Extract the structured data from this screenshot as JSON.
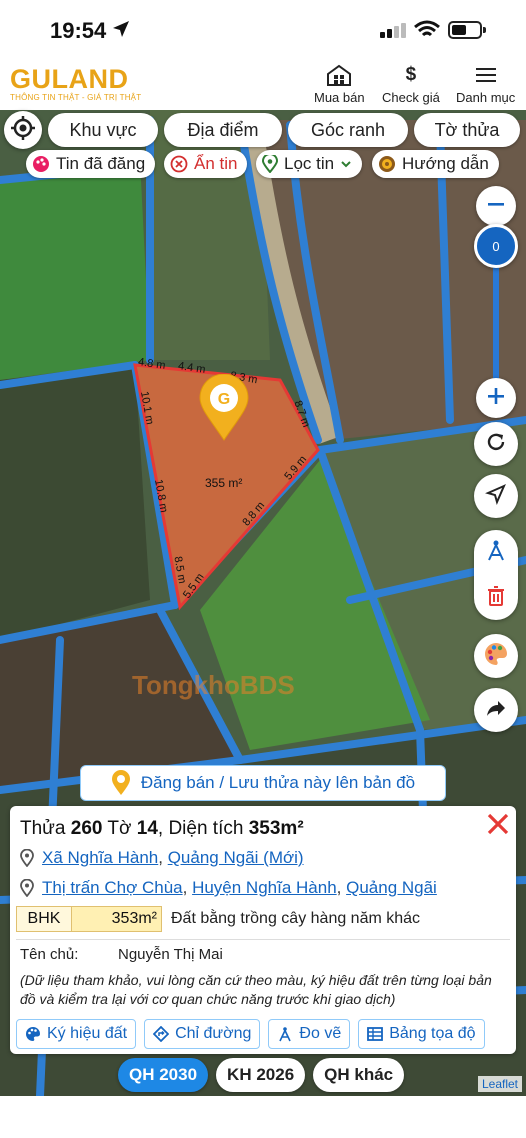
{
  "status_bar": {
    "time": "19:54",
    "battery_level": 0.55
  },
  "app": {
    "logo_text": "GULAND",
    "logo_tagline": "THÔNG TIN THẬT - GIÁ TRỊ THẬT",
    "menu": [
      {
        "label": "Mua bán",
        "icon": "house-grid-icon"
      },
      {
        "label": "Check giá",
        "icon": "dollar-icon"
      },
      {
        "label": "Danh mục",
        "icon": "hamburger-icon"
      }
    ]
  },
  "search_tabs": [
    "Khu vực",
    "Địa điểm",
    "Góc ranh",
    "Tờ thửa"
  ],
  "filters": {
    "posted": "Tin đã đăng",
    "hide": "Ẩn tin",
    "filter": "Lọc tin",
    "guide": "Hướng dẫn"
  },
  "map": {
    "zoom_value": "0",
    "area_label": "355 m²",
    "segments": [
      "4.8 m",
      "4.4 m",
      "8.3 m",
      "8.7 m",
      "5.9 m",
      "8.8 m",
      "5.5 m",
      "8.5 m",
      "10.8 m",
      "10.1 m"
    ],
    "watermark": "TongkhoBDS",
    "parcel_color": "#c8693f",
    "boundary_color": "#e53935",
    "road_color": "#2f7fd3"
  },
  "post_button": "Đăng bán / Lưu thửa này lên bản đồ",
  "parcel": {
    "title_prefix": "Thửa",
    "thua": "260",
    "to_label": "Tờ",
    "to": "14",
    "area_label": ", Diện tích",
    "area": "353m²",
    "address1": {
      "ward": "Xã Nghĩa Hành",
      "province": "Quảng Ngãi (Mới)"
    },
    "address2": {
      "town": "Thị trấn Chợ Chùa",
      "district": "Huyện Nghĩa Hành",
      "province": "Quảng Ngãi"
    },
    "land_code": "BHK",
    "land_area": "353m²",
    "land_desc": "Đất bằng trồng cây hàng năm khác",
    "owner_label": "Tên chủ:",
    "owner_name": "Nguyễn Thị Mai",
    "note": "(Dữ liệu tham khảo, vui lòng căn cứ theo màu, ký hiệu đất trên từng loại bản đồ và kiểm tra lại với cơ quan chức năng trước khi giao dịch)"
  },
  "actions": [
    "Ký hiệu đất",
    "Chỉ đường",
    "Đo vẽ",
    "Bảng tọa độ"
  ],
  "plan_tabs": [
    "QH 2030",
    "KH 2026",
    "QH khác"
  ],
  "attribution": "Leaflet"
}
